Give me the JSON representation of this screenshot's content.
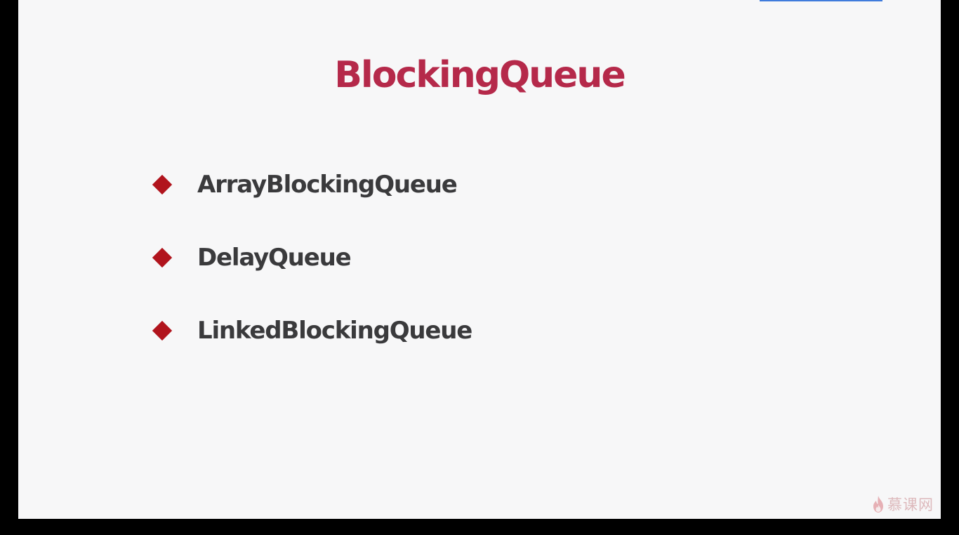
{
  "slide": {
    "title": "BlockingQueue",
    "bullets": [
      {
        "label": "ArrayBlockingQueue"
      },
      {
        "label": "DelayQueue"
      },
      {
        "label": "LinkedBlockingQueue"
      }
    ]
  },
  "watermark": {
    "icon": "flame-icon",
    "text": "慕课网"
  },
  "colors": {
    "title": "#b5294a",
    "bullet_marker": "#b1141d",
    "bullet_text": "#3a3a3c",
    "slide_background": "#f7f7f8",
    "frame_background": "#000000",
    "top_accent": "#3f7bdc"
  }
}
